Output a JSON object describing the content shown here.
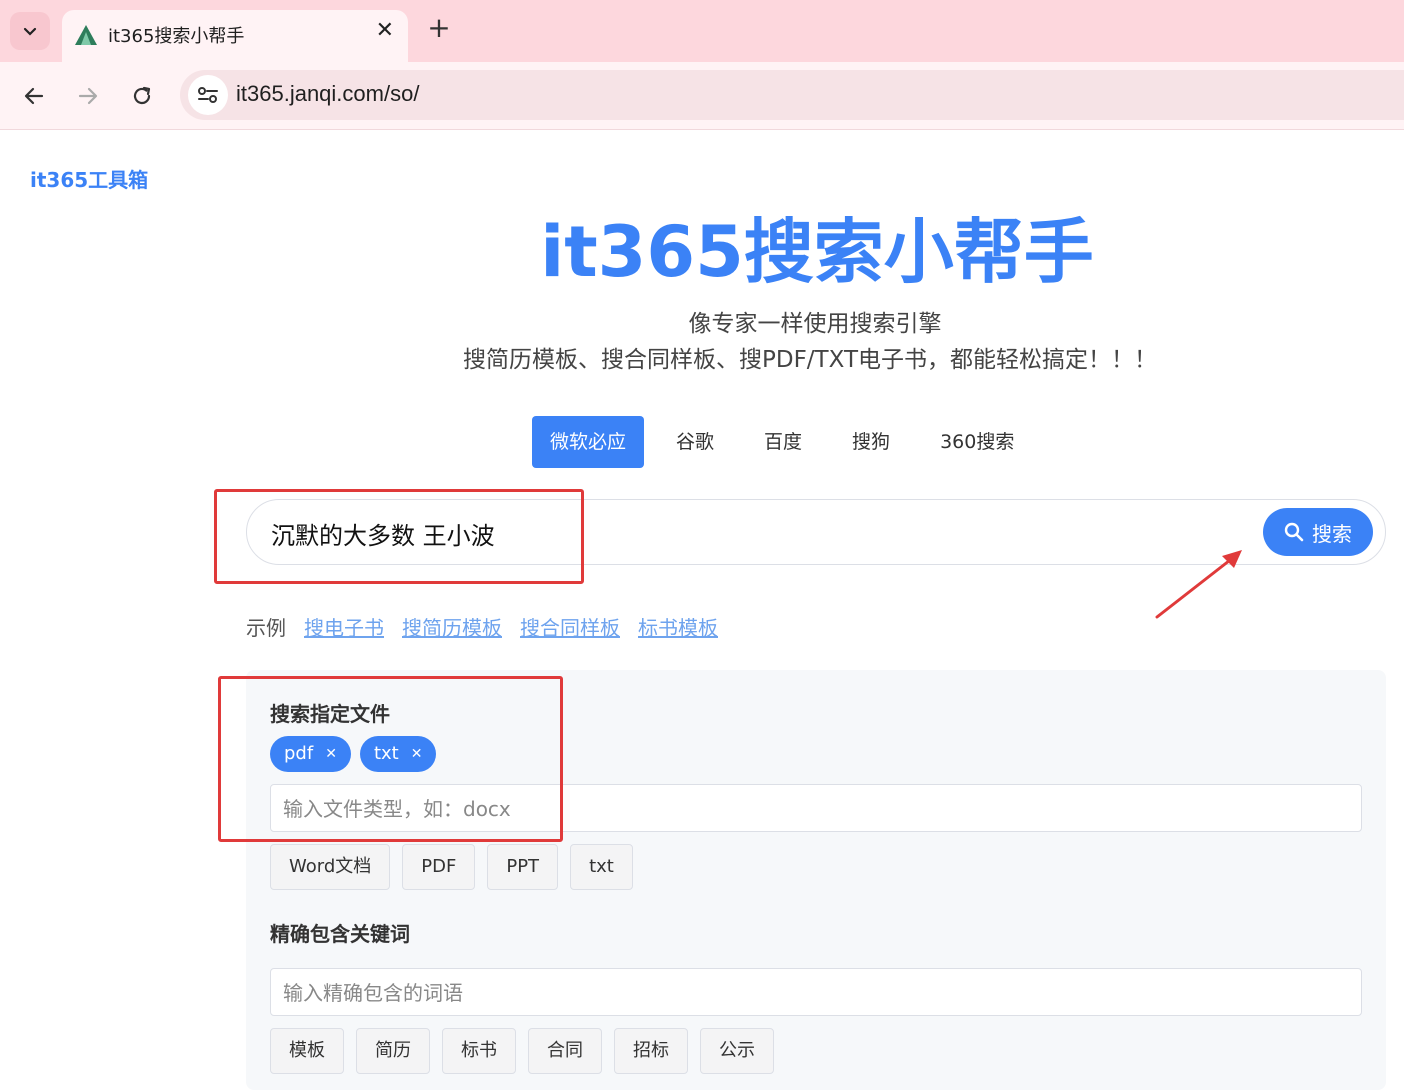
{
  "browser": {
    "tab_title": "it365搜索小帮手",
    "url": "it365.janqi.com/so/"
  },
  "page": {
    "brand_link": "it365工具箱",
    "hero_title": "it365搜索小帮手",
    "subtitle_line1": "像专家一样使用搜索引擎",
    "subtitle_line2": "搜简历模板、搜合同样板、搜PDF/TXT电子书，都能轻松搞定！！！",
    "engines": [
      {
        "label": "微软必应",
        "active": true
      },
      {
        "label": "谷歌",
        "active": false
      },
      {
        "label": "百度",
        "active": false
      },
      {
        "label": "搜狗",
        "active": false
      },
      {
        "label": "360搜索",
        "active": false
      }
    ],
    "search": {
      "value": "沉默的大多数 王小波",
      "button_label": "搜索"
    },
    "examples": {
      "label": "示例",
      "links": [
        "搜电子书",
        "搜简历模板",
        "搜合同样板",
        "标书模板"
      ]
    },
    "file_filter": {
      "title": "搜索指定文件",
      "selected_tags": [
        "pdf",
        "txt"
      ],
      "placeholder": "输入文件类型，如：docx",
      "quick_options": [
        "Word文档",
        "PDF",
        "PPT",
        "txt"
      ]
    },
    "keyword_filter": {
      "title": "精确包含关键词",
      "placeholder": "输入精确包含的词语",
      "quick_options": [
        "模板",
        "简历",
        "标书",
        "合同",
        "招标",
        "公示"
      ]
    }
  },
  "colors": {
    "accent": "#3b82f6",
    "annotation": "#e03a3a",
    "tabbar_bg": "#fdd7dd"
  }
}
